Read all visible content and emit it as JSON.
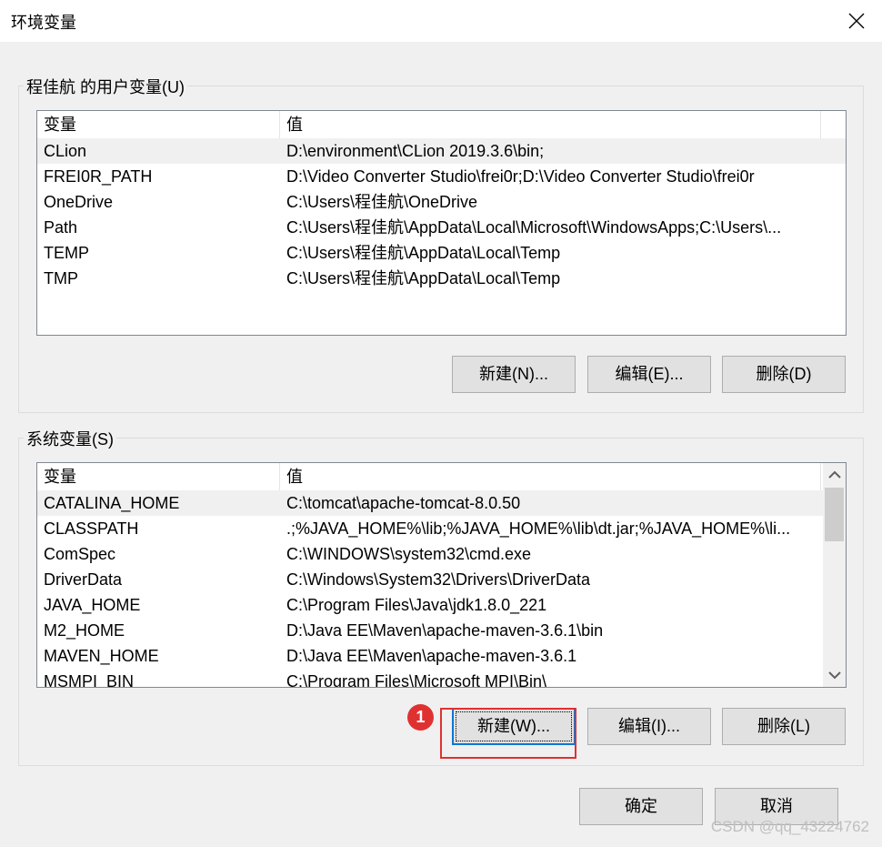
{
  "window": {
    "title": "环境变量"
  },
  "user_vars": {
    "group_title": "程佳航 的用户变量(U)",
    "columns": [
      "变量",
      "值"
    ],
    "rows": [
      {
        "name": "CLion",
        "value": "D:\\environment\\CLion 2019.3.6\\bin;"
      },
      {
        "name": "FREI0R_PATH",
        "value": "D:\\Video Converter Studio\\frei0r;D:\\Video Converter Studio\\frei0r"
      },
      {
        "name": "OneDrive",
        "value": "C:\\Users\\程佳航\\OneDrive"
      },
      {
        "name": "Path",
        "value": "C:\\Users\\程佳航\\AppData\\Local\\Microsoft\\WindowsApps;C:\\Users\\..."
      },
      {
        "name": "TEMP",
        "value": "C:\\Users\\程佳航\\AppData\\Local\\Temp"
      },
      {
        "name": "TMP",
        "value": "C:\\Users\\程佳航\\AppData\\Local\\Temp"
      }
    ],
    "buttons": {
      "new": "新建(N)...",
      "edit": "编辑(E)...",
      "delete": "删除(D)"
    }
  },
  "system_vars": {
    "group_title": "系统变量(S)",
    "columns": [
      "变量",
      "值"
    ],
    "rows": [
      {
        "name": "CATALINA_HOME",
        "value": "C:\\tomcat\\apache-tomcat-8.0.50"
      },
      {
        "name": "CLASSPATH",
        "value": ".;%JAVA_HOME%\\lib;%JAVA_HOME%\\lib\\dt.jar;%JAVA_HOME%\\li..."
      },
      {
        "name": "ComSpec",
        "value": "C:\\WINDOWS\\system32\\cmd.exe"
      },
      {
        "name": "DriverData",
        "value": "C:\\Windows\\System32\\Drivers\\DriverData"
      },
      {
        "name": "JAVA_HOME",
        "value": "C:\\Program Files\\Java\\jdk1.8.0_221"
      },
      {
        "name": "M2_HOME",
        "value": "D:\\Java EE\\Maven\\apache-maven-3.6.1\\bin"
      },
      {
        "name": "MAVEN_HOME",
        "value": "D:\\Java EE\\Maven\\apache-maven-3.6.1"
      },
      {
        "name": "MSMPI_BIN",
        "value": "C:\\Program Files\\Microsoft MPI\\Bin\\"
      }
    ],
    "buttons": {
      "new": "新建(W)...",
      "edit": "编辑(I)...",
      "delete": "删除(L)"
    }
  },
  "dialog_buttons": {
    "ok": "确定",
    "cancel": "取消"
  },
  "annotation": {
    "marker_label": "1",
    "color": "#e03131"
  },
  "watermark": "CSDN @qq_43224762",
  "colors": {
    "accent": "#0078d7",
    "selected_row": "#f0f0f0",
    "button_face": "#e1e1e1"
  }
}
